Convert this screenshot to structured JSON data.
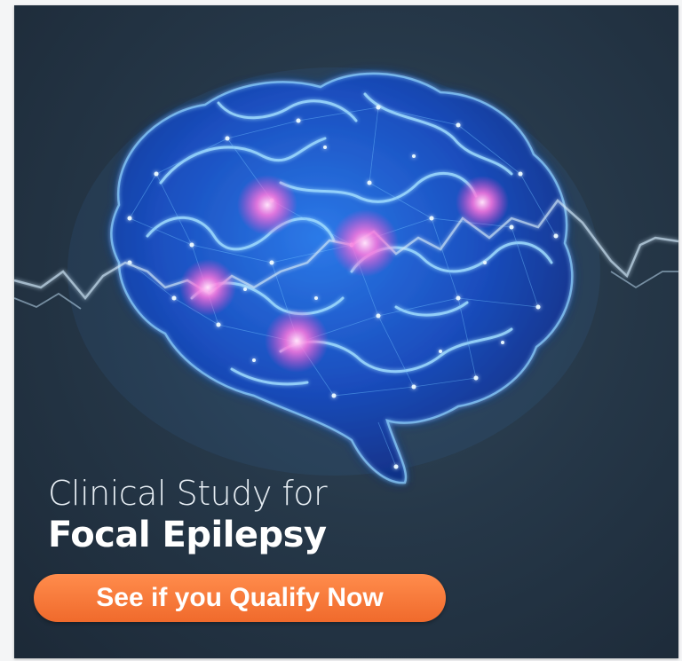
{
  "ad": {
    "headline_line1": "Clinical Study for",
    "headline_line2": "Focal Epilepsy",
    "cta_label": "See if you Qualify Now"
  },
  "colors": {
    "background": "#263849",
    "brain_glow": "#3aa6ff",
    "hotspot": "#ff7ad9",
    "cta": "#f4783a",
    "text": "#ffffff"
  },
  "illustration": {
    "subject": "brain-illustration",
    "icon": "brain-network-icon"
  }
}
